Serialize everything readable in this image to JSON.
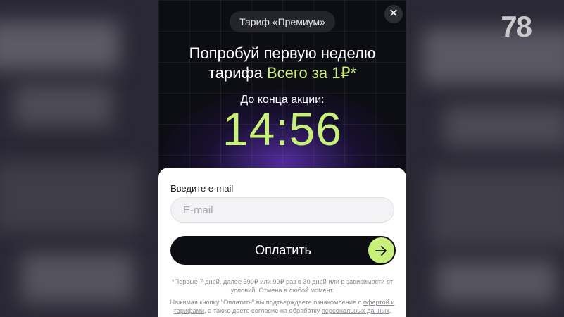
{
  "watermark": "78",
  "modal": {
    "close_icon": "close-icon",
    "tariff_label": "Тариф «Премиум»",
    "headline_line1": "Попробуй первую неделю",
    "headline_prefix": "тарифа ",
    "headline_accent": "Всего за 1₽*",
    "countdown_label": "До конца акции:",
    "timer": "14:56"
  },
  "form": {
    "email_label": "Введите e-mail",
    "email_placeholder": "E-mail",
    "email_value": "",
    "pay_label": "Оплатить",
    "pay_icon": "arrow-right-icon"
  },
  "terms": {
    "line1": "*Первые 7 дней, далее 399₽ или 99₽ раз в 30 дней или в зависимости от условий. Отмена в любой момент.",
    "line2_prefix": "Нажимая кнопку \"Оплатить\" вы подтверждаете ознакомление с ",
    "link_offer": "офертой и тарифами",
    "line2_middle": ", а также даете согласие на обработку ",
    "link_personal": "персональных данных",
    "line2_suffix": "."
  },
  "colors": {
    "accent": "#c9f07a",
    "modal_bg": "#0d0d14",
    "glow": "#5c30b2"
  }
}
